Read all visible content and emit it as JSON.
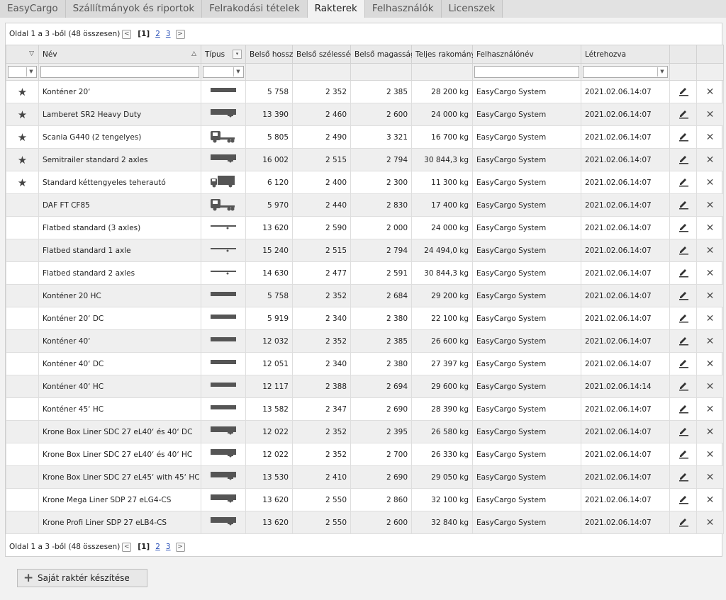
{
  "tabs": [
    "EasyCargo",
    "Szállítmányok és riportok",
    "Felrakodási tételek",
    "Rakterek",
    "Felhasználók",
    "Licenszek"
  ],
  "active_tab": 3,
  "pager": {
    "text": "Oldal 1 a 3 -ből (48 összesen)",
    "prev": "<",
    "current": "[1]",
    "page2": "2",
    "page3": "3",
    "next": ">"
  },
  "columns": {
    "star": "▽",
    "name": "Név",
    "type": "Típus",
    "length": "Belső hossz",
    "width": "Belső szélesség",
    "height": "Belső magasság",
    "payload": "Teljes rakomány",
    "user": "Felhasználónév",
    "created": "Létrehozva"
  },
  "icon_names": {
    "container": "container-icon",
    "trailer": "trailer-icon",
    "truck": "truck-cab-icon",
    "lorry": "box-truck-icon",
    "flatbed": "flatbed-icon"
  },
  "rows": [
    {
      "star": true,
      "name": "Konténer 20‘",
      "icon": "container",
      "length": "5 758",
      "width": "2 352",
      "height": "2 385",
      "payload": "28 200 kg",
      "user": "EasyCargo System",
      "created": "2021.02.06.14:07"
    },
    {
      "star": true,
      "name": "Lamberet SR2 Heavy Duty",
      "icon": "trailer",
      "length": "13 390",
      "width": "2 460",
      "height": "2 600",
      "payload": "24 000 kg",
      "user": "EasyCargo System",
      "created": "2021.02.06.14:07"
    },
    {
      "star": true,
      "name": "Scania G440 (2 tengelyes)",
      "icon": "truck",
      "length": "5 805",
      "width": "2 490",
      "height": "3 321",
      "payload": "16 700 kg",
      "user": "EasyCargo System",
      "created": "2021.02.06.14:07"
    },
    {
      "star": true,
      "name": "Semitrailer standard 2 axles",
      "icon": "trailer",
      "length": "16 002",
      "width": "2 515",
      "height": "2 794",
      "payload": "30 844,3 kg",
      "user": "EasyCargo System",
      "created": "2021.02.06.14:07"
    },
    {
      "star": true,
      "name": "Standard kéttengyeles teherautó",
      "icon": "lorry",
      "length": "6 120",
      "width": "2 400",
      "height": "2 300",
      "payload": "11 300 kg",
      "user": "EasyCargo System",
      "created": "2021.02.06.14:07"
    },
    {
      "star": false,
      "name": "DAF FT CF85",
      "icon": "truck",
      "length": "5 970",
      "width": "2 440",
      "height": "2 830",
      "payload": "17 400 kg",
      "user": "EasyCargo System",
      "created": "2021.02.06.14:07"
    },
    {
      "star": false,
      "name": "Flatbed standard (3 axles)",
      "icon": "flatbed",
      "length": "13 620",
      "width": "2 590",
      "height": "2 000",
      "payload": "24 000 kg",
      "user": "EasyCargo System",
      "created": "2021.02.06.14:07"
    },
    {
      "star": false,
      "name": "Flatbed standard 1 axle",
      "icon": "flatbed",
      "length": "15 240",
      "width": "2 515",
      "height": "2 794",
      "payload": "24 494,0 kg",
      "user": "EasyCargo System",
      "created": "2021.02.06.14:07"
    },
    {
      "star": false,
      "name": "Flatbed standard 2 axles",
      "icon": "flatbed",
      "length": "14 630",
      "width": "2 477",
      "height": "2 591",
      "payload": "30 844,3 kg",
      "user": "EasyCargo System",
      "created": "2021.02.06.14:07"
    },
    {
      "star": false,
      "name": "Konténer 20 HC",
      "icon": "container",
      "length": "5 758",
      "width": "2 352",
      "height": "2 684",
      "payload": "29 200 kg",
      "user": "EasyCargo System",
      "created": "2021.02.06.14:07"
    },
    {
      "star": false,
      "name": "Konténer 20‘ DC",
      "icon": "container",
      "length": "5 919",
      "width": "2 340",
      "height": "2 380",
      "payload": "22 100 kg",
      "user": "EasyCargo System",
      "created": "2021.02.06.14:07"
    },
    {
      "star": false,
      "name": "Konténer 40‘",
      "icon": "container",
      "length": "12 032",
      "width": "2 352",
      "height": "2 385",
      "payload": "26 600 kg",
      "user": "EasyCargo System",
      "created": "2021.02.06.14:07"
    },
    {
      "star": false,
      "name": "Konténer 40‘ DC",
      "icon": "container",
      "length": "12 051",
      "width": "2 340",
      "height": "2 380",
      "payload": "27 397 kg",
      "user": "EasyCargo System",
      "created": "2021.02.06.14:07"
    },
    {
      "star": false,
      "name": "Konténer 40‘ HC",
      "icon": "container",
      "length": "12 117",
      "width": "2 388",
      "height": "2 694",
      "payload": "29 600 kg",
      "user": "EasyCargo System",
      "created": "2021.02.06.14:14"
    },
    {
      "star": false,
      "name": "Konténer 45‘ HC",
      "icon": "container",
      "length": "13 582",
      "width": "2 347",
      "height": "2 690",
      "payload": "28 390 kg",
      "user": "EasyCargo System",
      "created": "2021.02.06.14:07"
    },
    {
      "star": false,
      "name": "Krone Box Liner SDC 27 eL40‘ és 40‘ DC",
      "icon": "trailer",
      "length": "12 022",
      "width": "2 352",
      "height": "2 395",
      "payload": "26 580 kg",
      "user": "EasyCargo System",
      "created": "2021.02.06.14:07"
    },
    {
      "star": false,
      "name": "Krone Box Liner SDC 27 eL40‘ és 40‘ HC",
      "icon": "trailer",
      "length": "12 022",
      "width": "2 352",
      "height": "2 700",
      "payload": "26 330 kg",
      "user": "EasyCargo System",
      "created": "2021.02.06.14:07"
    },
    {
      "star": false,
      "name": "Krone Box Liner SDC 27 eL45‘ with 45‘ HC",
      "icon": "trailer",
      "length": "13 530",
      "width": "2 410",
      "height": "2 690",
      "payload": "29 050 kg",
      "user": "EasyCargo System",
      "created": "2021.02.06.14:07"
    },
    {
      "star": false,
      "name": "Krone Mega Liner SDP 27 eLG4-CS",
      "icon": "trailer",
      "length": "13 620",
      "width": "2 550",
      "height": "2 860",
      "payload": "32 100 kg",
      "user": "EasyCargo System",
      "created": "2021.02.06.14:07"
    },
    {
      "star": false,
      "name": "Krone Profi Liner SDP 27 eLB4-CS",
      "icon": "trailer",
      "length": "13 620",
      "width": "2 550",
      "height": "2 600",
      "payload": "32 840 kg",
      "user": "EasyCargo System",
      "created": "2021.02.06.14:07"
    }
  ],
  "new_button": "Saját raktér készítése"
}
